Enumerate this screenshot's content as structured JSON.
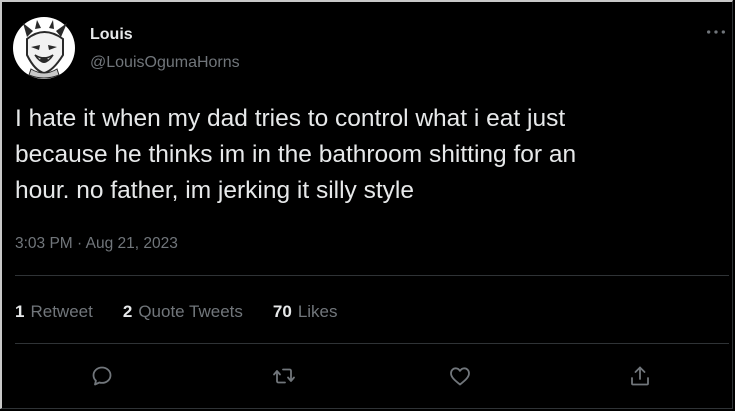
{
  "tweet": {
    "author": {
      "display_name": "Louis",
      "handle": "@LouisOgumaHorns",
      "avatar_icon": "wolf-avatar-icon"
    },
    "text_lines": [
      "I hate it when my dad tries to control what i eat just",
      "because he thinks im in the bathroom shitting for an",
      "hour. no father, im jerking it silly style"
    ],
    "time": "3:03 PM",
    "separator": "·",
    "date": "Aug 21, 2023",
    "stats": {
      "retweets": {
        "count": "1",
        "label": "Retweet"
      },
      "quote_tweets": {
        "count": "2",
        "label": "Quote Tweets"
      },
      "likes": {
        "count": "70",
        "label": "Likes"
      }
    },
    "actions": [
      "reply-icon",
      "retweet-icon",
      "like-icon",
      "share-icon"
    ],
    "more_icon": "more-options-icon"
  },
  "colors": {
    "background": "#000000",
    "text_primary": "#e7e9ea",
    "text_secondary": "#71767b",
    "divider": "#2f3336"
  }
}
